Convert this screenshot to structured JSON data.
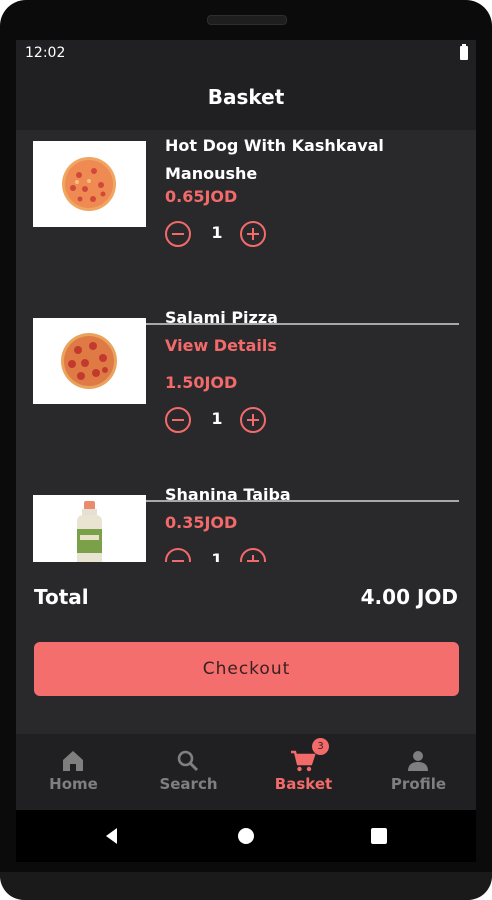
{
  "status_bar": {
    "time": "12:02"
  },
  "app_bar": {
    "title": "Basket"
  },
  "basket_items": [
    {
      "name": "Hot Dog With Kashkaval Manoushe",
      "link": "",
      "price": "0.65JOD",
      "quantity": "1",
      "image": "pepperoni-manoushe"
    },
    {
      "name": "Salami Pizza",
      "link": "View Details",
      "price": "1.50JOD",
      "quantity": "1",
      "image": "salami-pizza"
    },
    {
      "name": "Shanina Taiba",
      "link": "",
      "price": "0.35JOD",
      "quantity": "1",
      "image": "drink-bottle"
    }
  ],
  "summary": {
    "total_label": "Total",
    "total_value": "4.00 JOD"
  },
  "checkout": {
    "label": "Checkout"
  },
  "bottom_nav": {
    "items": [
      {
        "label": "Home",
        "icon": "home-icon",
        "active": false
      },
      {
        "label": "Search",
        "icon": "search-icon",
        "active": false
      },
      {
        "label": "Basket",
        "icon": "cart-icon",
        "active": true,
        "badge": "3"
      },
      {
        "label": "Profile",
        "icon": "profile-icon",
        "active": false
      }
    ]
  },
  "colors": {
    "accent": "#f36a6a",
    "background": "#29292c",
    "bar_background": "#202022",
    "text": "#ffffff",
    "inactive": "#7f7f7f"
  }
}
